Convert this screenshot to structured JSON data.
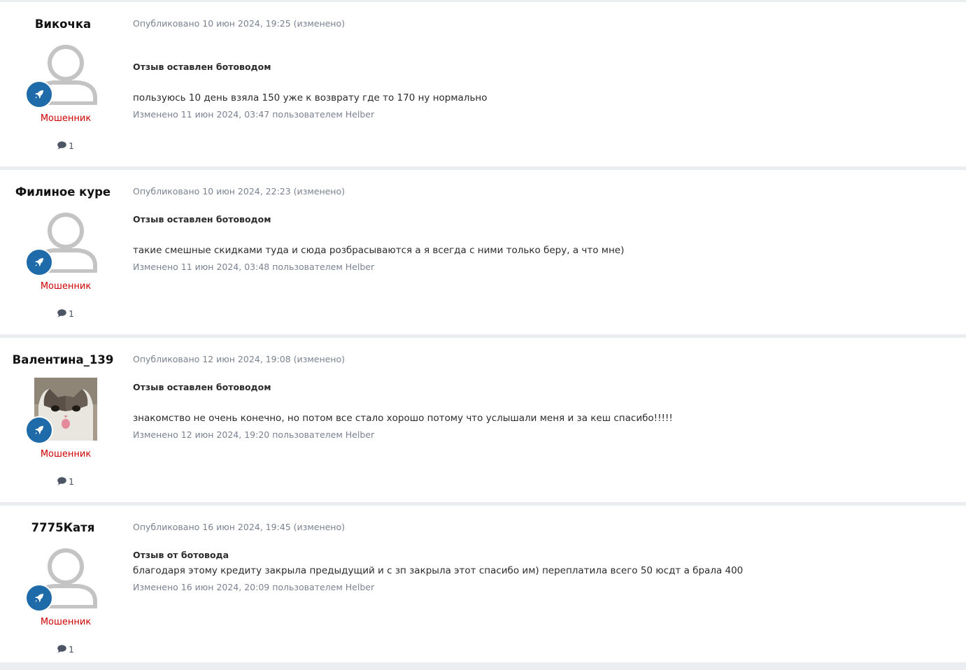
{
  "posts": [
    {
      "author": "Викочка",
      "avatar": "default-avatar",
      "group": "Мошенник",
      "post_count": "1",
      "published": "Опубликовано 10 июн 2024, 19:25 (изменено)",
      "notice": "Отзыв оставлен ботоводом",
      "body": "пользуюсь 10 день взяла 150 уже к возврату где то 170 ну нормально",
      "edited": "Изменено 11 июн 2024, 03:47 пользователем Helber"
    },
    {
      "author": "Филиное куре",
      "avatar": "default-avatar",
      "group": "Мошенник",
      "post_count": "1",
      "published": "Опубликовано 10 июн 2024, 22:23 (изменено)",
      "notice": "Отзыв оставлен ботоводом",
      "body": "такие смешные скидками туда и сюда розбрасываются а я всегда с ними только беру, а что мне)",
      "edited": "Изменено 11 июн 2024, 03:48 пользователем Helber"
    },
    {
      "author": "Валентина_139",
      "avatar": "cat-photo-avatar",
      "group": "Мошенник",
      "post_count": "1",
      "published": "Опубликовано 12 июн 2024, 19:08 (изменено)",
      "notice": "Отзыв оставлен ботоводом",
      "body": "знакомство не очень конечно, но потом все стало хорошо потому что услышали меня и за кеш спасибо!!!!!",
      "edited": "Изменено 12 июн 2024, 19:20 пользователем Helber"
    },
    {
      "author": "7775Катя",
      "avatar": "default-avatar",
      "group": "Мошенник",
      "post_count": "1",
      "published": "Опубликовано 16 июн 2024, 19:45 (изменено)",
      "notice": "Отзыв от ботовода",
      "body": "благодаря этому кредиту закрыла предыдущий и с зп закрыла этот спасибо им) переплатила всего 50 юсдт а брала 400",
      "edited": "Изменено 16 июн 2024, 20:09 пользователем Helber"
    }
  ],
  "colors": {
    "group_label": "#cc0000",
    "rank_badge": "#1f6aa8",
    "meta_text": "#7a8290",
    "page_background": "#ebedf0"
  },
  "icons": {
    "rank_badge": "rocket-icon",
    "post_count": "comment-icon",
    "default_avatar": "user-silhouette-icon"
  }
}
